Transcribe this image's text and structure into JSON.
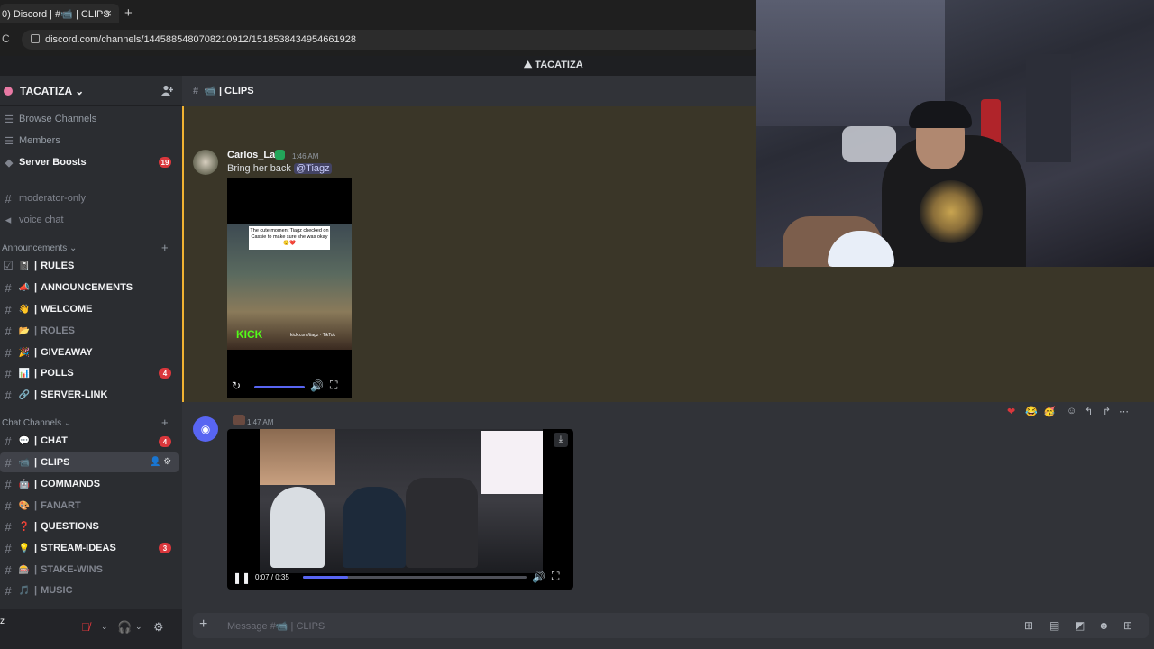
{
  "browser": {
    "tab_title": "0) Discord | #📹 | CLIPS",
    "tab_close": "×",
    "new_tab": "+",
    "reload": "C",
    "url": "discord.com/channels/1445885480708210912/1518538434954661928"
  },
  "server": {
    "name": "TACATIZA",
    "chevron": "⌄",
    "topbar_label": "TACATIZA"
  },
  "sidebar": {
    "top_items": [
      {
        "label": "Browse Channels",
        "icon": "grid-icon"
      },
      {
        "label": "Members",
        "icon": "members-icon"
      },
      {
        "label": "Server Boosts",
        "icon": "boost-icon",
        "badge": "19"
      }
    ],
    "loose_channels": [
      "moderator-only",
      "voice chat"
    ],
    "categories": [
      {
        "name": "Announcements",
        "channels": [
          {
            "emoji": "📓",
            "name": "RULES",
            "bold": true
          },
          {
            "emoji": "📣",
            "name": "ANNOUNCEMENTS",
            "bold": true
          },
          {
            "emoji": "👋",
            "name": "WELCOME",
            "bold": true
          },
          {
            "emoji": "📂",
            "name": "ROLES",
            "bold": false
          },
          {
            "emoji": "🎉",
            "name": "GIVEAWAY",
            "bold": true
          },
          {
            "emoji": "📊",
            "name": "POLLS",
            "bold": true,
            "badge": "4"
          },
          {
            "emoji": "🔗",
            "name": "SERVER-LINK",
            "bold": true
          }
        ]
      },
      {
        "name": "Chat Channels",
        "channels": [
          {
            "emoji": "💬",
            "name": "CHAT",
            "bold": true,
            "badge": "4"
          },
          {
            "emoji": "📹",
            "name": "CLIPS",
            "bold": true,
            "active": true
          },
          {
            "emoji": "🤖",
            "name": "COMMANDS",
            "bold": true
          },
          {
            "emoji": "🎨",
            "name": "FANART",
            "bold": false
          },
          {
            "emoji": "❓",
            "name": "QUESTIONS",
            "bold": true
          },
          {
            "emoji": "💡",
            "name": "STREAM-IDEAS",
            "bold": true,
            "badge": "3"
          },
          {
            "emoji": "🎰",
            "name": "STAKE-WINS",
            "bold": false
          },
          {
            "emoji": "🎵",
            "name": "MUSIC",
            "bold": false
          }
        ]
      }
    ],
    "user_short": "z"
  },
  "channel": {
    "title": "CLIPS",
    "emoji": "📹"
  },
  "messages": [
    {
      "author": "Carlos_La",
      "time": "1:46 AM",
      "text": "Bring her back",
      "mention": "@Tiagz",
      "video_caption": "The cute moment Tiagz checked on Cassie to make sure she was okay😌❤️",
      "video_brand": "KICK",
      "video_tag": "kick.com/tiagz · TikTok"
    },
    {
      "time": "1:47 AM",
      "video_time": "0:07 / 0:35",
      "progress": 0.2
    }
  ],
  "composer": {
    "plus": "+",
    "placeholder": "Message #📹 | CLIPS"
  },
  "colors": {
    "accent": "#5865f2",
    "badge": "#da373c",
    "highlight_border": "#f0b232",
    "kick_green": "#53fc18"
  }
}
